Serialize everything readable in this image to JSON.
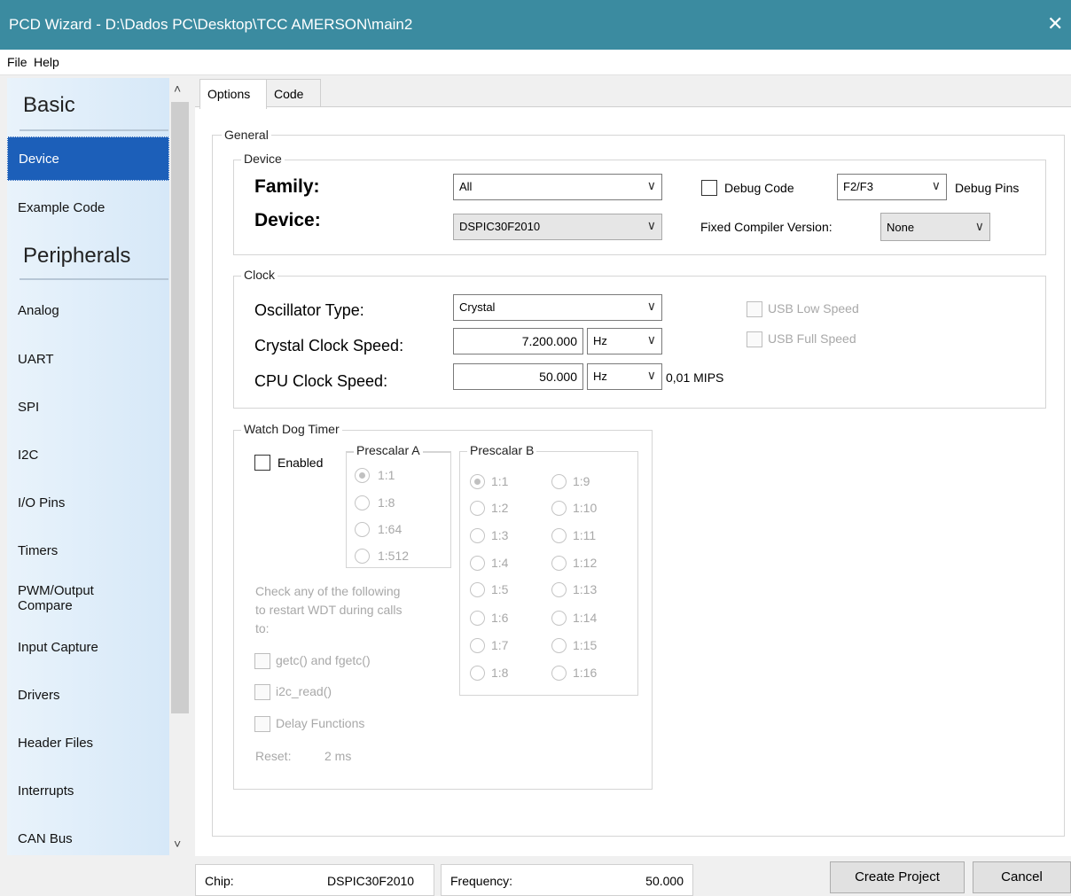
{
  "window": {
    "title": "PCD Wizard - D:\\Dados PC\\Desktop\\TCC AMERSON\\main2",
    "close_icon": "✕"
  },
  "menu": [
    "File",
    "Help"
  ],
  "sidebar": {
    "heading_basic": "Basic",
    "heading_peripherals": "Peripherals",
    "basic_items": [
      "Device",
      "Example Code"
    ],
    "peripheral_items": [
      "Analog",
      "UART",
      "SPI",
      "I2C",
      "I/O Pins",
      "Timers",
      "PWM/Output Compare",
      "Input Capture",
      "Drivers",
      "Header Files",
      "Interrupts",
      "CAN Bus"
    ],
    "active": "Device"
  },
  "tabs": [
    "Options",
    "Code"
  ],
  "general": {
    "label": "General",
    "device_group": {
      "label": "Device",
      "family_label": "Family:",
      "family_value": "All",
      "device_label": "Device:",
      "device_value": "DSPIC30F2010",
      "debug_code_label": "Debug Code",
      "debug_select_value": "F2/F3",
      "debug_pins_label": "Debug Pins",
      "fixed_compiler_label": "Fixed Compiler Version:",
      "fixed_compiler_value": "None"
    },
    "clock_group": {
      "label": "Clock",
      "osc_type_label": "Oscillator Type:",
      "osc_type_value": "Crystal",
      "crystal_speed_label": "Crystal Clock Speed:",
      "crystal_speed_value": "7.200.000",
      "crystal_unit": "Hz",
      "cpu_speed_label": "CPU Clock Speed:",
      "cpu_speed_value": "50.000",
      "cpu_unit": "Hz",
      "mips": "0,01 MIPS",
      "usb_low": "USB Low Speed",
      "usb_full": "USB Full Speed"
    },
    "wdt_group": {
      "label": "Watch Dog Timer",
      "enabled_label": "Enabled",
      "prescalar_a_label": "Prescalar A",
      "prescalar_a": [
        "1:1",
        "1:8",
        "1:64",
        "1:512"
      ],
      "prescalar_b_label": "Prescalar B",
      "prescalar_b_col1": [
        "1:1",
        "1:2",
        "1:3",
        "1:4",
        "1:5",
        "1:6",
        "1:7",
        "1:8"
      ],
      "prescalar_b_col2": [
        "1:9",
        "1:10",
        "1:11",
        "1:12",
        "1:13",
        "1:14",
        "1:15",
        "1:16"
      ],
      "restart_line1": "Check any of the following",
      "restart_line2": "to restart WDT during calls",
      "restart_line3": "to:",
      "opt_getc": "getc() and fgetc()",
      "opt_i2c": "i2c_read()",
      "opt_delay": "Delay Functions",
      "reset_label": "Reset:",
      "reset_value": "2 ms"
    }
  },
  "status": {
    "chip_label": "Chip:",
    "chip_value": "DSPIC30F2010",
    "freq_label": "Frequency:",
    "freq_value": "50.000"
  },
  "buttons": {
    "create": "Create Project",
    "cancel": "Cancel"
  }
}
